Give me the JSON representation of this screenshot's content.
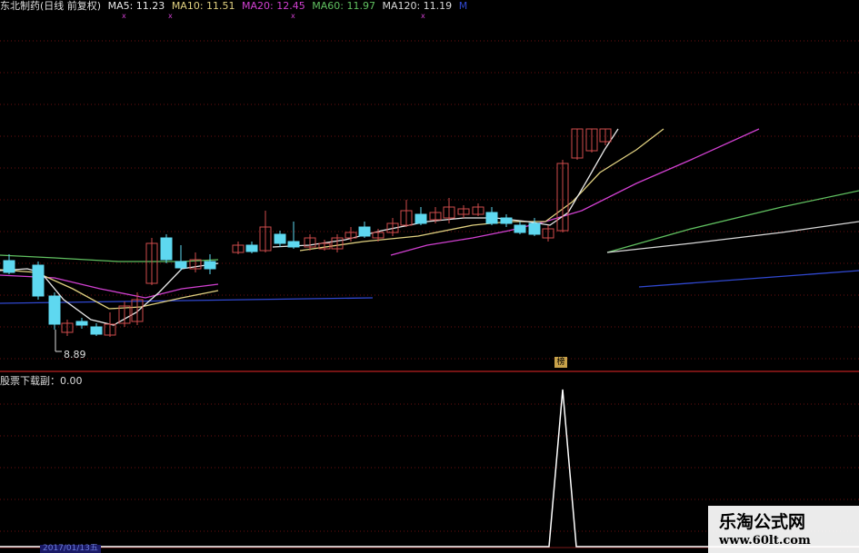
{
  "header": {
    "stock": "东北制药(日线 前复权)",
    "ma5": "MA5: 11.23",
    "ma10": "MA10: 11.51",
    "ma20": "MA20: 12.45",
    "ma60": "MA60: 11.97",
    "ma120": "MA120: 11.19",
    "extra": "M"
  },
  "annotations": {
    "low_price": "8.89",
    "marker": "榜"
  },
  "indicator": {
    "label": "股票下载副：0.00"
  },
  "footer": {
    "date": "2017/01/13五"
  },
  "watermark": {
    "title": "乐淘公式网",
    "url": "www.60lt.com"
  },
  "colors": {
    "background": "#000000",
    "divider": "#9a1a1a",
    "grid": "#6a1010",
    "candle_up": "#d04c4c",
    "candle_down": "#5ed8f0",
    "ma5": "#e8e8e8",
    "ma10": "#e0d080",
    "ma20": "#d040d0",
    "ma60": "#60c060",
    "ma120": "#d8d8d8",
    "ma250": "#3048d0",
    "indicator_line": "#ffffff"
  }
}
